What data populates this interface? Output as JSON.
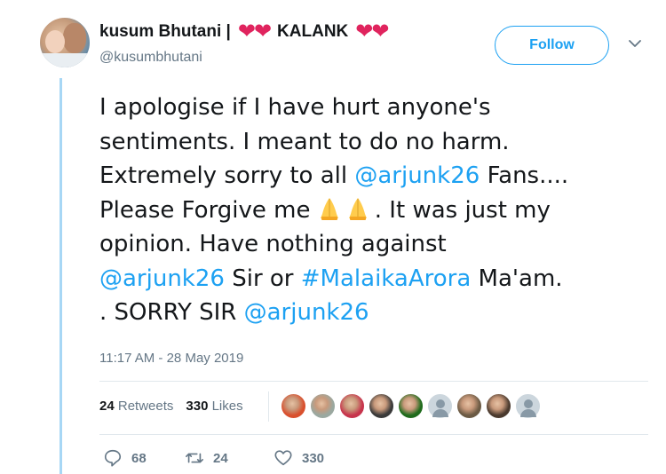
{
  "user": {
    "display_name_prefix": "kusum Bhutani |",
    "hearts_left": "❤❤",
    "display_name_middle": "KALANK",
    "hearts_right": "❤❤",
    "handle": "@kusumbhutani"
  },
  "follow_button": {
    "label": "Follow"
  },
  "tweet": {
    "line1": "I apologise if I have hurt anyone's",
    "line2": "sentiments. I meant to do no harm.",
    "line3_pre": "Extremely sorry to all ",
    "mention1": "@arjunk26",
    "line3_post": "  Fans....",
    "line4_pre": "Please Forgive me",
    "line4_post": ". It was just my",
    "line5": "opinion. Have nothing against",
    "mention2": "@arjunk26",
    "line6_mid": " Sir or ",
    "hashtag": "#MalaikaArora",
    "line6_post": "  Ma'am.",
    "line7_pre": ". SORRY SIR ",
    "mention3": "@arjunk26"
  },
  "timestamp": "11:17 AM - 28 May 2019",
  "stats": {
    "retweets_count": "24",
    "retweets_label": "Retweets",
    "likes_count": "330",
    "likes_label": "Likes"
  },
  "liker_avatars": [
    {
      "name": "liker-avatar-1",
      "color": "#d9502e"
    },
    {
      "name": "liker-avatar-2",
      "color": "#9aa8a0"
    },
    {
      "name": "liker-avatar-3",
      "color": "#c7344c"
    },
    {
      "name": "liker-avatar-4",
      "color": "#3a3a3a"
    },
    {
      "name": "liker-avatar-5",
      "color": "#1f6b1c"
    },
    {
      "name": "liker-avatar-6",
      "color": "default"
    },
    {
      "name": "liker-avatar-7",
      "color": "#6b5a44"
    },
    {
      "name": "liker-avatar-8",
      "color": "#4a3a2e"
    },
    {
      "name": "liker-avatar-9",
      "color": "default"
    }
  ],
  "actions": {
    "replies": "68",
    "retweets": "24",
    "likes": "330"
  },
  "colors": {
    "accent": "#1da1f2",
    "heart": "#e0245e",
    "muted": "#657786",
    "thread_line": "#a7d7f5"
  }
}
